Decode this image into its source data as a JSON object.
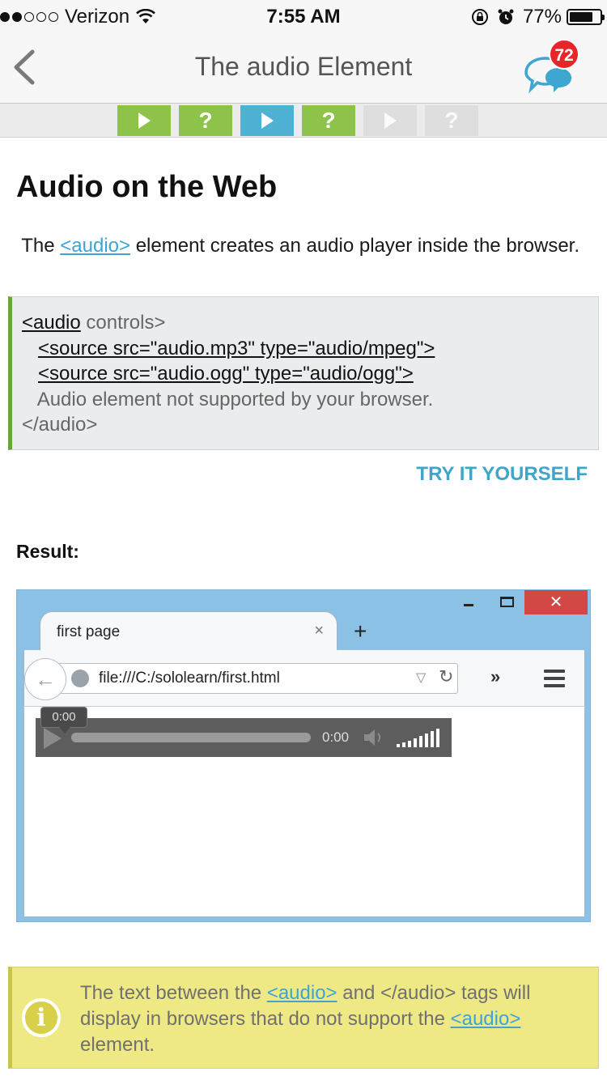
{
  "status_bar": {
    "carrier": "Verizon",
    "time": "7:55 AM",
    "battery": "77%",
    "battery_level": 0.77,
    "signal_bars": 2
  },
  "nav": {
    "title": "The audio Element",
    "comment_count": "72"
  },
  "progress_steps": [
    {
      "type": "play",
      "state": "done",
      "glyph": ""
    },
    {
      "type": "quiz",
      "state": "done",
      "glyph": "?"
    },
    {
      "type": "play",
      "state": "current",
      "glyph": ""
    },
    {
      "type": "quiz",
      "state": "done",
      "glyph": "?"
    },
    {
      "type": "play",
      "state": "locked",
      "glyph": ""
    },
    {
      "type": "quiz",
      "state": "locked",
      "glyph": "?"
    }
  ],
  "lesson": {
    "heading": "Audio on the Web",
    "intro_before": " The ",
    "intro_link": "<audio>",
    "intro_after": " element creates an audio player inside the browser.",
    "code": {
      "line1_tag": "<audio",
      "line1_rest": " controls>",
      "line2": "<source src=\"audio.mp3\" type=\"audio/mpeg\">",
      "line3": "<source src=\"audio.ogg\" type=\"audio/ogg\">",
      "line4": "Audio element not supported by your browser.",
      "line5": "</audio>"
    },
    "try_label": "TRY IT YOURSELF",
    "result_label": "Result:"
  },
  "result_browser": {
    "close_glyph": "✕",
    "tab_title": "first page",
    "tab_close": "×",
    "new_tab": "+",
    "url": "file:///C:/sololearn/first.html",
    "reload_glyph": "↻",
    "overflow_glyph": "»",
    "player_time": "0:00",
    "tooltip_time": "0:00"
  },
  "note": {
    "part1": "The text between the ",
    "link1": "<audio>",
    "part2": " and </audio> tags will display in browsers that do not support the ",
    "link2": "<audio>",
    "part3": " element."
  },
  "colors": {
    "step_done": "#8dc34b",
    "step_current": "#4fb1d4",
    "step_locked": "#dedede",
    "link": "#3fa3d6",
    "badge": "#e8262a",
    "note_bg": "#eee985",
    "code_border": "#66a73c"
  }
}
